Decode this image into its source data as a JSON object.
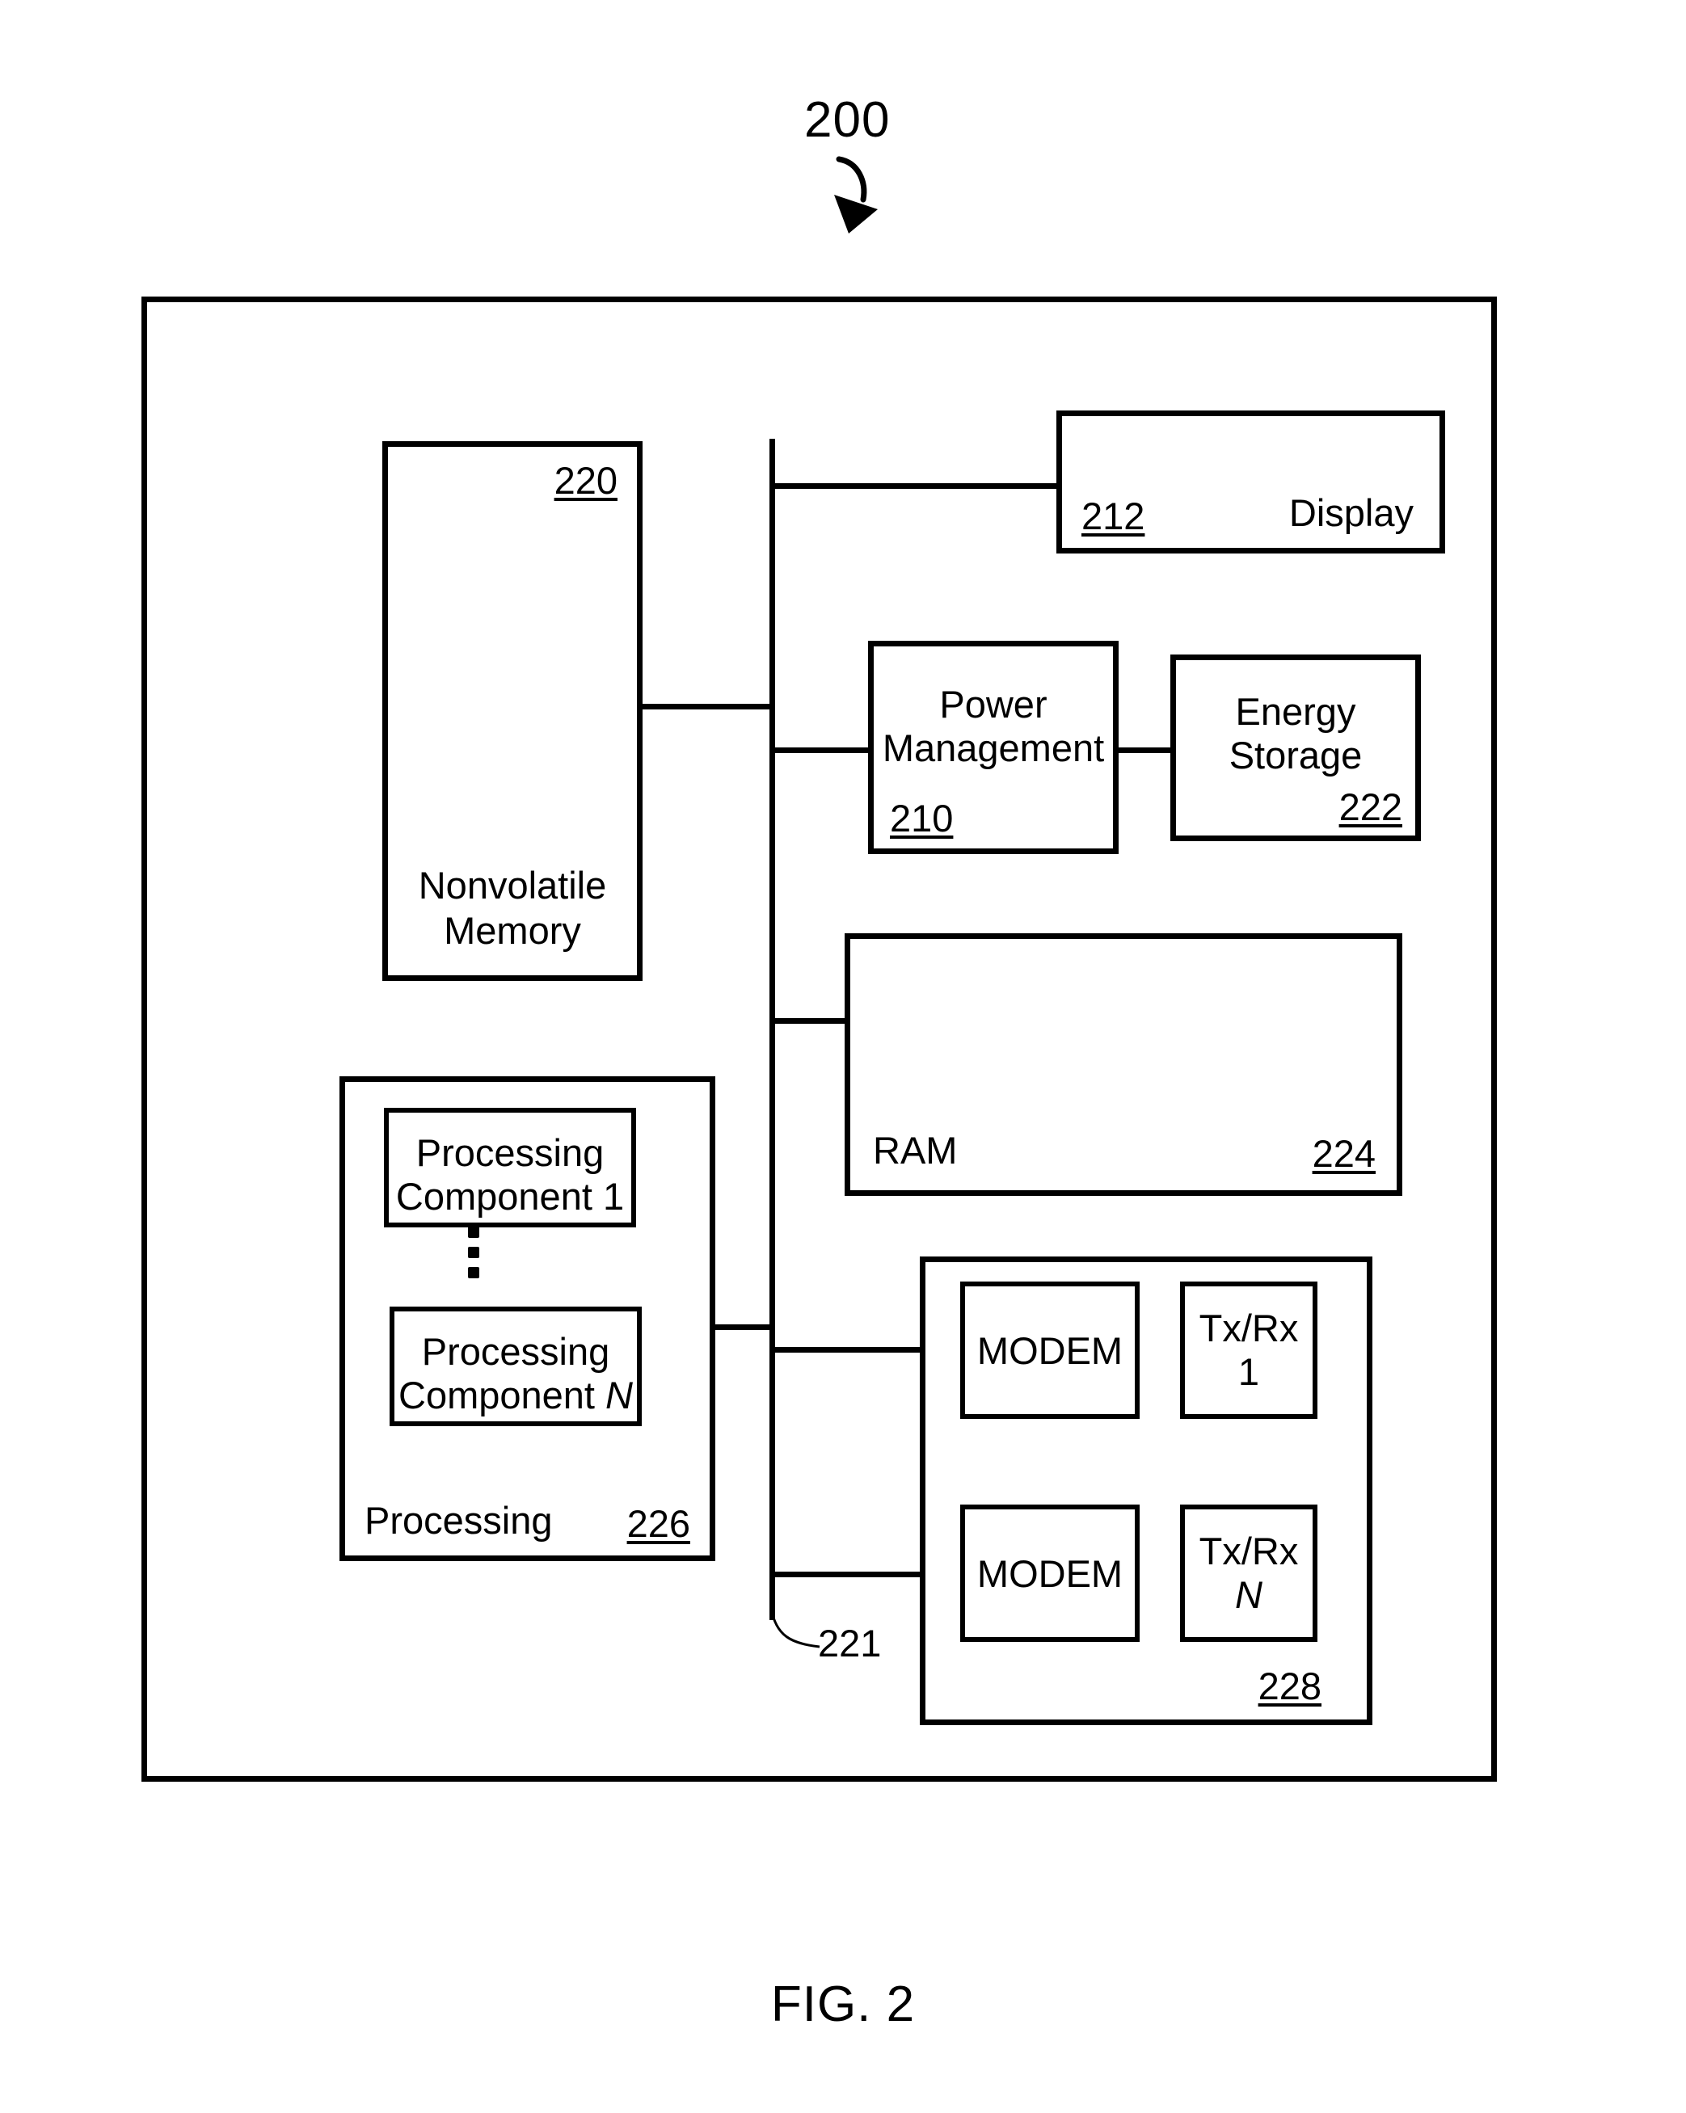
{
  "figure": {
    "caption": "FIG. 2",
    "system_ref": "200"
  },
  "bus": {
    "ref": "221"
  },
  "blocks": {
    "nonvolatile_memory": {
      "label_line1": "Nonvolatile",
      "label_line2": "Memory",
      "ref": "220"
    },
    "display": {
      "label": "Display",
      "ref": "212"
    },
    "power_management": {
      "label_line1": "Power",
      "label_line2": "Management",
      "ref": "210"
    },
    "energy_storage": {
      "label_line1": "Energy",
      "label_line2": "Storage",
      "ref": "222"
    },
    "ram": {
      "label": "RAM",
      "ref": "224"
    },
    "processing": {
      "label": "Processing",
      "ref": "226",
      "components": [
        {
          "label_line1": "Processing",
          "label_line2": "Component 1"
        },
        {
          "label_line1": "Processing",
          "label_line2": "Component N"
        }
      ],
      "ellipsis": "vertical-ellipsis"
    },
    "transceivers": {
      "ref": "228",
      "chains": [
        {
          "modem_label": "MODEM",
          "txrx_line1": "Tx/Rx",
          "txrx_line2": "1"
        },
        {
          "modem_label": "MODEM",
          "txrx_line1": "Tx/Rx",
          "txrx_line2": "N"
        }
      ]
    }
  },
  "colors": {
    "ink": "#000000",
    "paper": "#ffffff"
  }
}
